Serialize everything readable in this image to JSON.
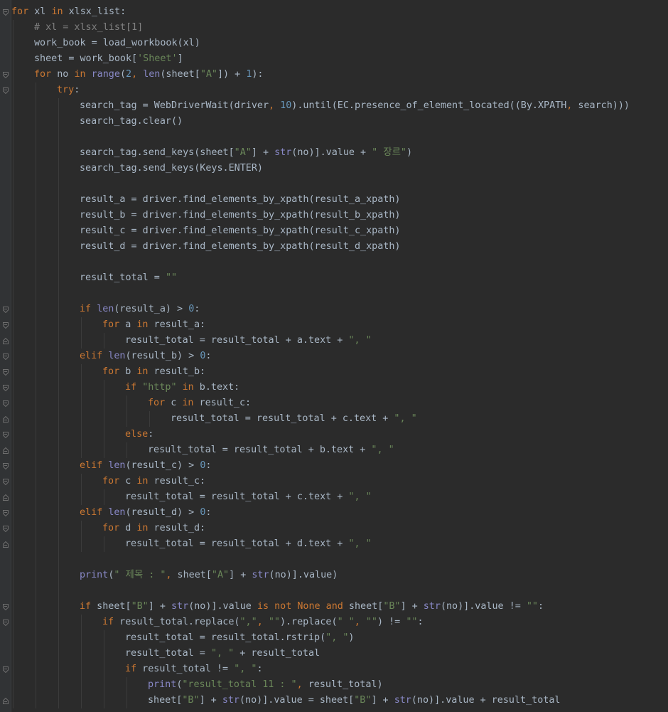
{
  "editor": {
    "background": "#2b2b2b",
    "colors": {
      "keyword": "#cc7832",
      "string": "#6a8759",
      "number": "#6897bb",
      "comment": "#808080",
      "builtin": "#8888c6",
      "identifier": "#a9b7c6"
    },
    "lines": [
      {
        "indent": 0,
        "fold": "open",
        "tokens": [
          [
            "kw",
            "for"
          ],
          [
            "id",
            " xl "
          ],
          [
            "kw",
            "in"
          ],
          [
            "id",
            " xlsx_list:"
          ]
        ]
      },
      {
        "indent": 1,
        "tokens": [
          [
            "cm",
            "# xl = xlsx_list[1]"
          ]
        ]
      },
      {
        "indent": 1,
        "tokens": [
          [
            "id",
            "work_book = load_workbook(xl)"
          ]
        ]
      },
      {
        "indent": 1,
        "tokens": [
          [
            "id",
            "sheet = work_book["
          ],
          [
            "str",
            "'Sheet'"
          ],
          [
            "id",
            "]"
          ]
        ]
      },
      {
        "indent": 1,
        "fold": "open",
        "tokens": [
          [
            "kw",
            "for"
          ],
          [
            "id",
            " no "
          ],
          [
            "kw",
            "in"
          ],
          [
            "id",
            " "
          ],
          [
            "bi",
            "range"
          ],
          [
            "id",
            "("
          ],
          [
            "num",
            "2"
          ],
          [
            "kw",
            ", "
          ],
          [
            "bi",
            "len"
          ],
          [
            "id",
            "(sheet["
          ],
          [
            "str",
            "\"A\""
          ],
          [
            "id",
            "]) + "
          ],
          [
            "num",
            "1"
          ],
          [
            "id",
            "):"
          ]
        ]
      },
      {
        "indent": 2,
        "fold": "open",
        "tokens": [
          [
            "kw",
            "try"
          ],
          [
            "id",
            ":"
          ]
        ]
      },
      {
        "indent": 3,
        "tokens": [
          [
            "id",
            "search_tag = WebDriverWait(driver"
          ],
          [
            "kw",
            ", "
          ],
          [
            "num",
            "10"
          ],
          [
            "id",
            ").until(EC.presence_of_element_located((By.XPATH"
          ],
          [
            "kw",
            ", "
          ],
          [
            "id",
            "search)))"
          ]
        ]
      },
      {
        "indent": 3,
        "tokens": [
          [
            "id",
            "search_tag.clear()"
          ]
        ]
      },
      {
        "indent": 3,
        "tokens": []
      },
      {
        "indent": 3,
        "tokens": [
          [
            "id",
            "search_tag.send_keys(sheet["
          ],
          [
            "str",
            "\"A\""
          ],
          [
            "id",
            "] + "
          ],
          [
            "bi",
            "str"
          ],
          [
            "id",
            "(no)].value + "
          ],
          [
            "str",
            "\" 장르\""
          ],
          [
            "id",
            ")"
          ]
        ]
      },
      {
        "indent": 3,
        "tokens": [
          [
            "id",
            "search_tag.send_keys(Keys.ENTER)"
          ]
        ]
      },
      {
        "indent": 3,
        "tokens": []
      },
      {
        "indent": 3,
        "tokens": [
          [
            "id",
            "result_a = driver.find_elements_by_xpath(result_a_xpath)"
          ]
        ]
      },
      {
        "indent": 3,
        "tokens": [
          [
            "id",
            "result_b = driver.find_elements_by_xpath(result_b_xpath)"
          ]
        ]
      },
      {
        "indent": 3,
        "tokens": [
          [
            "id",
            "result_c = driver.find_elements_by_xpath(result_c_xpath)"
          ]
        ]
      },
      {
        "indent": 3,
        "tokens": [
          [
            "id",
            "result_d = driver.find_elements_by_xpath(result_d_xpath)"
          ]
        ]
      },
      {
        "indent": 3,
        "tokens": []
      },
      {
        "indent": 3,
        "tokens": [
          [
            "id",
            "result_total = "
          ],
          [
            "str",
            "\"\""
          ]
        ]
      },
      {
        "indent": 3,
        "tokens": []
      },
      {
        "indent": 3,
        "fold": "open",
        "tokens": [
          [
            "kw",
            "if"
          ],
          [
            "id",
            " "
          ],
          [
            "bi",
            "len"
          ],
          [
            "id",
            "(result_a) > "
          ],
          [
            "num",
            "0"
          ],
          [
            "id",
            ":"
          ]
        ]
      },
      {
        "indent": 4,
        "fold": "open",
        "tokens": [
          [
            "kw",
            "for"
          ],
          [
            "id",
            " a "
          ],
          [
            "kw",
            "in"
          ],
          [
            "id",
            " result_a:"
          ]
        ]
      },
      {
        "indent": 5,
        "fold": "close",
        "tokens": [
          [
            "id",
            "result_total = result_total + a.text + "
          ],
          [
            "str",
            "\", \""
          ]
        ]
      },
      {
        "indent": 3,
        "fold": "open",
        "tokens": [
          [
            "kw",
            "elif"
          ],
          [
            "id",
            " "
          ],
          [
            "bi",
            "len"
          ],
          [
            "id",
            "(result_b) > "
          ],
          [
            "num",
            "0"
          ],
          [
            "id",
            ":"
          ]
        ]
      },
      {
        "indent": 4,
        "fold": "open",
        "tokens": [
          [
            "kw",
            "for"
          ],
          [
            "id",
            " b "
          ],
          [
            "kw",
            "in"
          ],
          [
            "id",
            " result_b:"
          ]
        ]
      },
      {
        "indent": 5,
        "fold": "open",
        "tokens": [
          [
            "kw",
            "if"
          ],
          [
            "id",
            " "
          ],
          [
            "str",
            "\"http\""
          ],
          [
            "id",
            " "
          ],
          [
            "kw",
            "in"
          ],
          [
            "id",
            " b.text:"
          ]
        ]
      },
      {
        "indent": 6,
        "fold": "open",
        "tokens": [
          [
            "kw",
            "for"
          ],
          [
            "id",
            " c "
          ],
          [
            "kw",
            "in"
          ],
          [
            "id",
            " result_c:"
          ]
        ]
      },
      {
        "indent": 7,
        "fold": "close",
        "tokens": [
          [
            "id",
            "result_total = result_total + c.text + "
          ],
          [
            "str",
            "\", \""
          ]
        ]
      },
      {
        "indent": 5,
        "fold": "open",
        "tokens": [
          [
            "kw",
            "else"
          ],
          [
            "id",
            ":"
          ]
        ]
      },
      {
        "indent": 6,
        "fold": "close",
        "tokens": [
          [
            "id",
            "result_total = result_total + b.text + "
          ],
          [
            "str",
            "\", \""
          ]
        ]
      },
      {
        "indent": 3,
        "fold": "open",
        "tokens": [
          [
            "kw",
            "elif"
          ],
          [
            "id",
            " "
          ],
          [
            "bi",
            "len"
          ],
          [
            "id",
            "(result_c) > "
          ],
          [
            "num",
            "0"
          ],
          [
            "id",
            ":"
          ]
        ]
      },
      {
        "indent": 4,
        "fold": "open",
        "tokens": [
          [
            "kw",
            "for"
          ],
          [
            "id",
            " c "
          ],
          [
            "kw",
            "in"
          ],
          [
            "id",
            " result_c:"
          ]
        ]
      },
      {
        "indent": 5,
        "fold": "close",
        "tokens": [
          [
            "id",
            "result_total = result_total + c.text + "
          ],
          [
            "str",
            "\", \""
          ]
        ]
      },
      {
        "indent": 3,
        "fold": "open",
        "tokens": [
          [
            "kw",
            "elif"
          ],
          [
            "id",
            " "
          ],
          [
            "bi",
            "len"
          ],
          [
            "id",
            "(result_d) > "
          ],
          [
            "num",
            "0"
          ],
          [
            "id",
            ":"
          ]
        ]
      },
      {
        "indent": 4,
        "fold": "open",
        "tokens": [
          [
            "kw",
            "for"
          ],
          [
            "id",
            " d "
          ],
          [
            "kw",
            "in"
          ],
          [
            "id",
            " result_d:"
          ]
        ]
      },
      {
        "indent": 5,
        "fold": "close",
        "tokens": [
          [
            "id",
            "result_total = result_total + d.text + "
          ],
          [
            "str",
            "\", \""
          ]
        ]
      },
      {
        "indent": 3,
        "tokens": []
      },
      {
        "indent": 3,
        "tokens": [
          [
            "bi",
            "print"
          ],
          [
            "id",
            "("
          ],
          [
            "str",
            "\" 제목 : \""
          ],
          [
            "kw",
            ", "
          ],
          [
            "id",
            "sheet["
          ],
          [
            "str",
            "\"A\""
          ],
          [
            "id",
            "] + "
          ],
          [
            "bi",
            "str"
          ],
          [
            "id",
            "(no)].value)"
          ]
        ]
      },
      {
        "indent": 3,
        "tokens": []
      },
      {
        "indent": 3,
        "fold": "open",
        "tokens": [
          [
            "kw",
            "if"
          ],
          [
            "id",
            " sheet["
          ],
          [
            "str",
            "\"B\""
          ],
          [
            "id",
            "] + "
          ],
          [
            "bi",
            "str"
          ],
          [
            "id",
            "(no)].value "
          ],
          [
            "kw",
            "is not None and"
          ],
          [
            "id",
            " sheet["
          ],
          [
            "str",
            "\"B\""
          ],
          [
            "id",
            "] + "
          ],
          [
            "bi",
            "str"
          ],
          [
            "id",
            "(no)].value != "
          ],
          [
            "str",
            "\"\""
          ],
          [
            "id",
            ":"
          ]
        ]
      },
      {
        "indent": 4,
        "fold": "open",
        "tokens": [
          [
            "kw",
            "if"
          ],
          [
            "id",
            " result_total.replace("
          ],
          [
            "str",
            "\",\""
          ],
          [
            "kw",
            ", "
          ],
          [
            "str",
            "\"\""
          ],
          [
            "id",
            ").replace("
          ],
          [
            "str",
            "\" \""
          ],
          [
            "kw",
            ", "
          ],
          [
            "str",
            "\"\""
          ],
          [
            "id",
            ") != "
          ],
          [
            "str",
            "\"\""
          ],
          [
            "id",
            ":"
          ]
        ]
      },
      {
        "indent": 5,
        "tokens": [
          [
            "id",
            "result_total = result_total.rstrip("
          ],
          [
            "str",
            "\", \""
          ],
          [
            "id",
            ")"
          ]
        ]
      },
      {
        "indent": 5,
        "tokens": [
          [
            "id",
            "result_total = "
          ],
          [
            "str",
            "\", \""
          ],
          [
            "id",
            " + result_total"
          ]
        ]
      },
      {
        "indent": 5,
        "fold": "open",
        "tokens": [
          [
            "kw",
            "if"
          ],
          [
            "id",
            " result_total != "
          ],
          [
            "str",
            "\", \""
          ],
          [
            "id",
            ":"
          ]
        ]
      },
      {
        "indent": 6,
        "tokens": [
          [
            "bi",
            "print"
          ],
          [
            "id",
            "("
          ],
          [
            "str",
            "\"result_total 11 : \""
          ],
          [
            "kw",
            ", "
          ],
          [
            "id",
            "result_total)"
          ]
        ]
      },
      {
        "indent": 6,
        "fold": "close",
        "tokens": [
          [
            "id",
            "sheet["
          ],
          [
            "str",
            "\"B\""
          ],
          [
            "id",
            "] + "
          ],
          [
            "bi",
            "str"
          ],
          [
            "id",
            "(no)].value = sheet["
          ],
          [
            "str",
            "\"B\""
          ],
          [
            "id",
            "] + "
          ],
          [
            "bi",
            "str"
          ],
          [
            "id",
            "(no)].value + result_total"
          ]
        ]
      }
    ]
  }
}
